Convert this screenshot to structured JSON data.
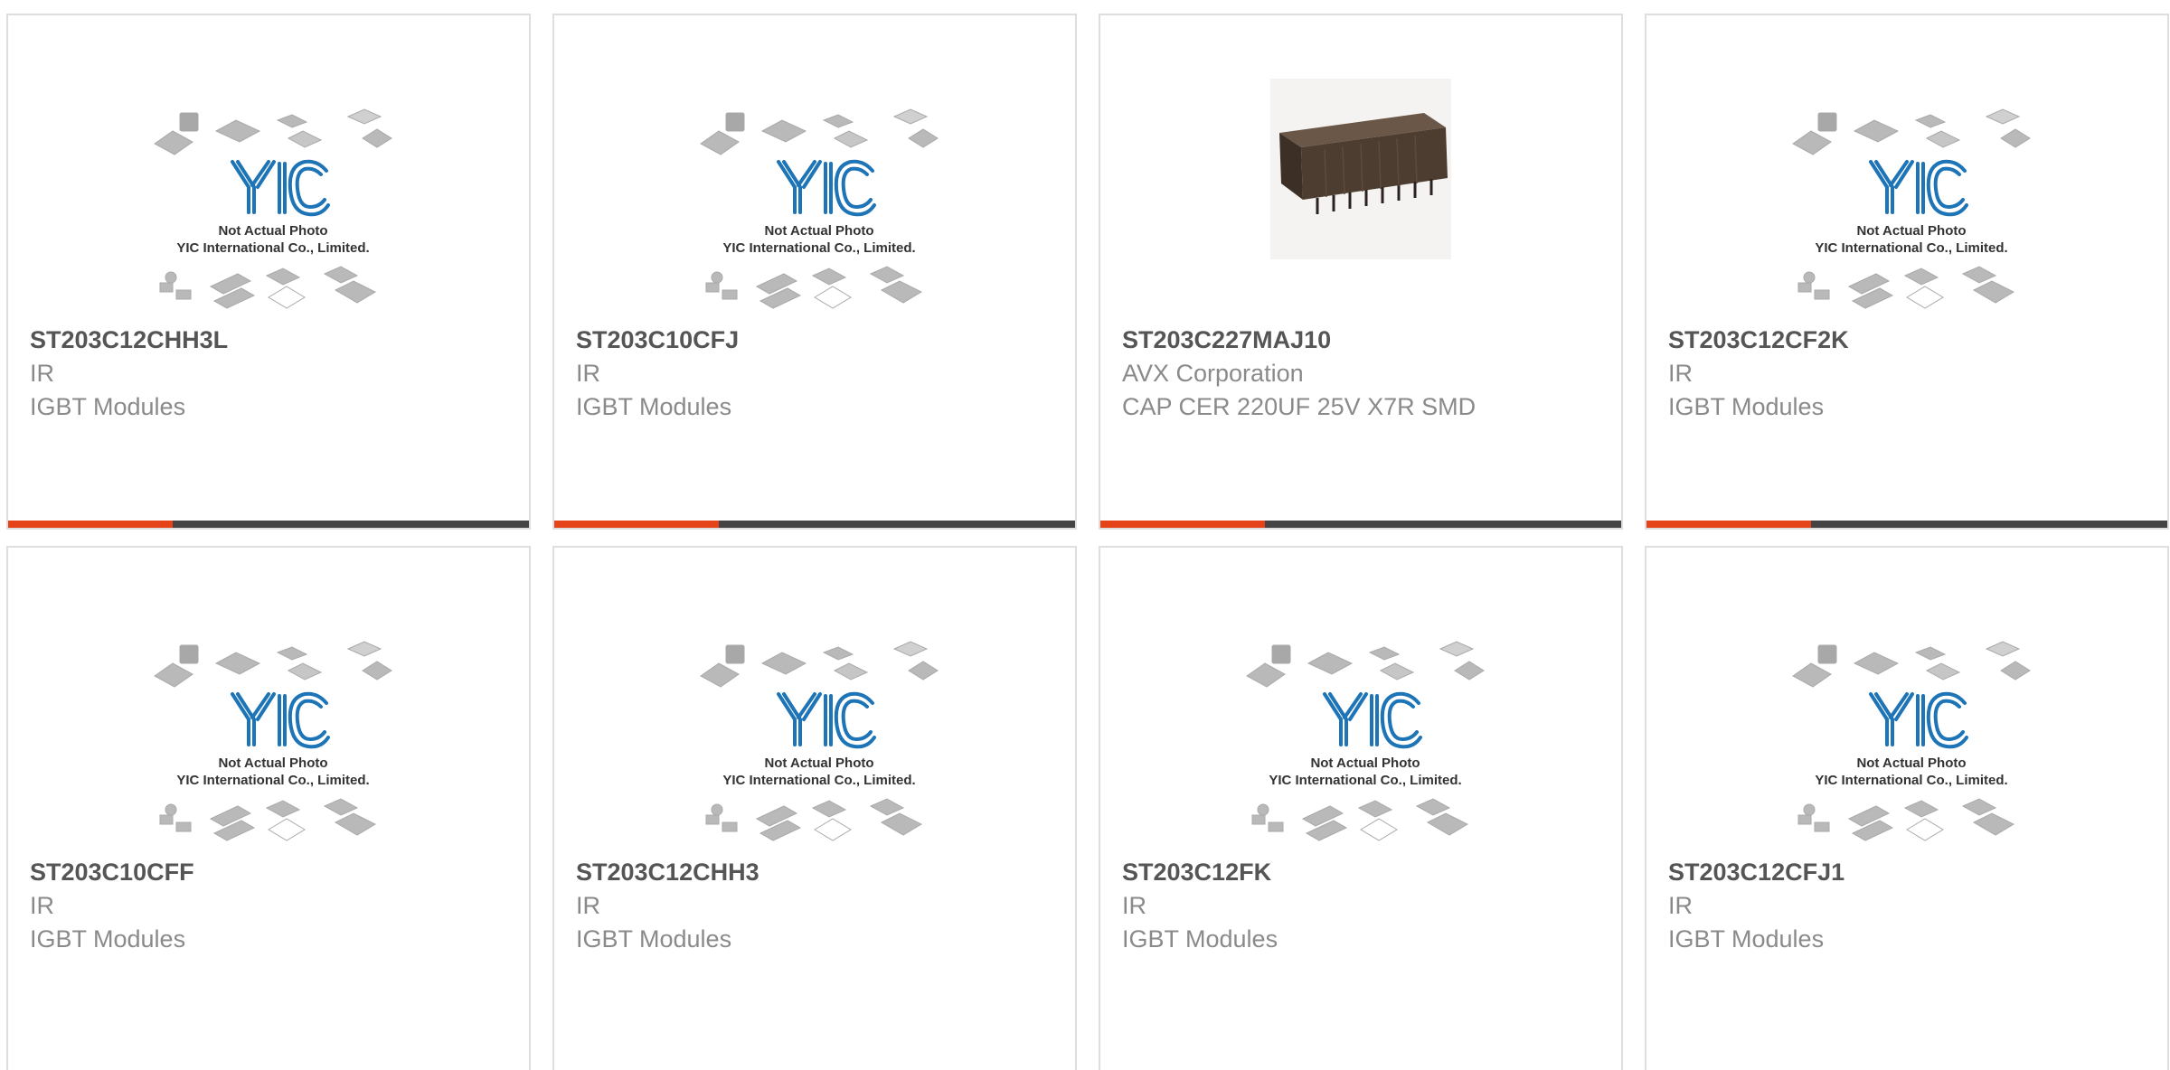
{
  "placeholder": {
    "line1": "Not Actual Photo",
    "line2": "YIC International Co., Limited.",
    "logo": "YIC"
  },
  "colors": {
    "accent": "#e5431a",
    "bar": "#444444",
    "logo": "#1d74b6",
    "title": "#555555",
    "subtitle": "#8a8a8a"
  },
  "products": [
    {
      "part": "ST203C12CHH3L",
      "manufacturer": "IR",
      "description": "IGBT Modules",
      "image": "placeholder"
    },
    {
      "part": "ST203C10CFJ",
      "manufacturer": "IR",
      "description": "IGBT Modules",
      "image": "placeholder"
    },
    {
      "part": "ST203C227MAJ10",
      "manufacturer": "AVX Corporation",
      "description": "CAP CER 220UF 25V X7R SMD",
      "image": "capacitor-photo"
    },
    {
      "part": "ST203C12CF2K",
      "manufacturer": "IR",
      "description": "IGBT Modules",
      "image": "placeholder"
    },
    {
      "part": "ST203C10CFF",
      "manufacturer": "IR",
      "description": "IGBT Modules",
      "image": "placeholder"
    },
    {
      "part": "ST203C12CHH3",
      "manufacturer": "IR",
      "description": "IGBT Modules",
      "image": "placeholder"
    },
    {
      "part": "ST203C12FK",
      "manufacturer": "IR",
      "description": "IGBT Modules",
      "image": "placeholder"
    },
    {
      "part": "ST203C12CFJ1",
      "manufacturer": "IR",
      "description": "IGBT Modules",
      "image": "placeholder"
    }
  ]
}
